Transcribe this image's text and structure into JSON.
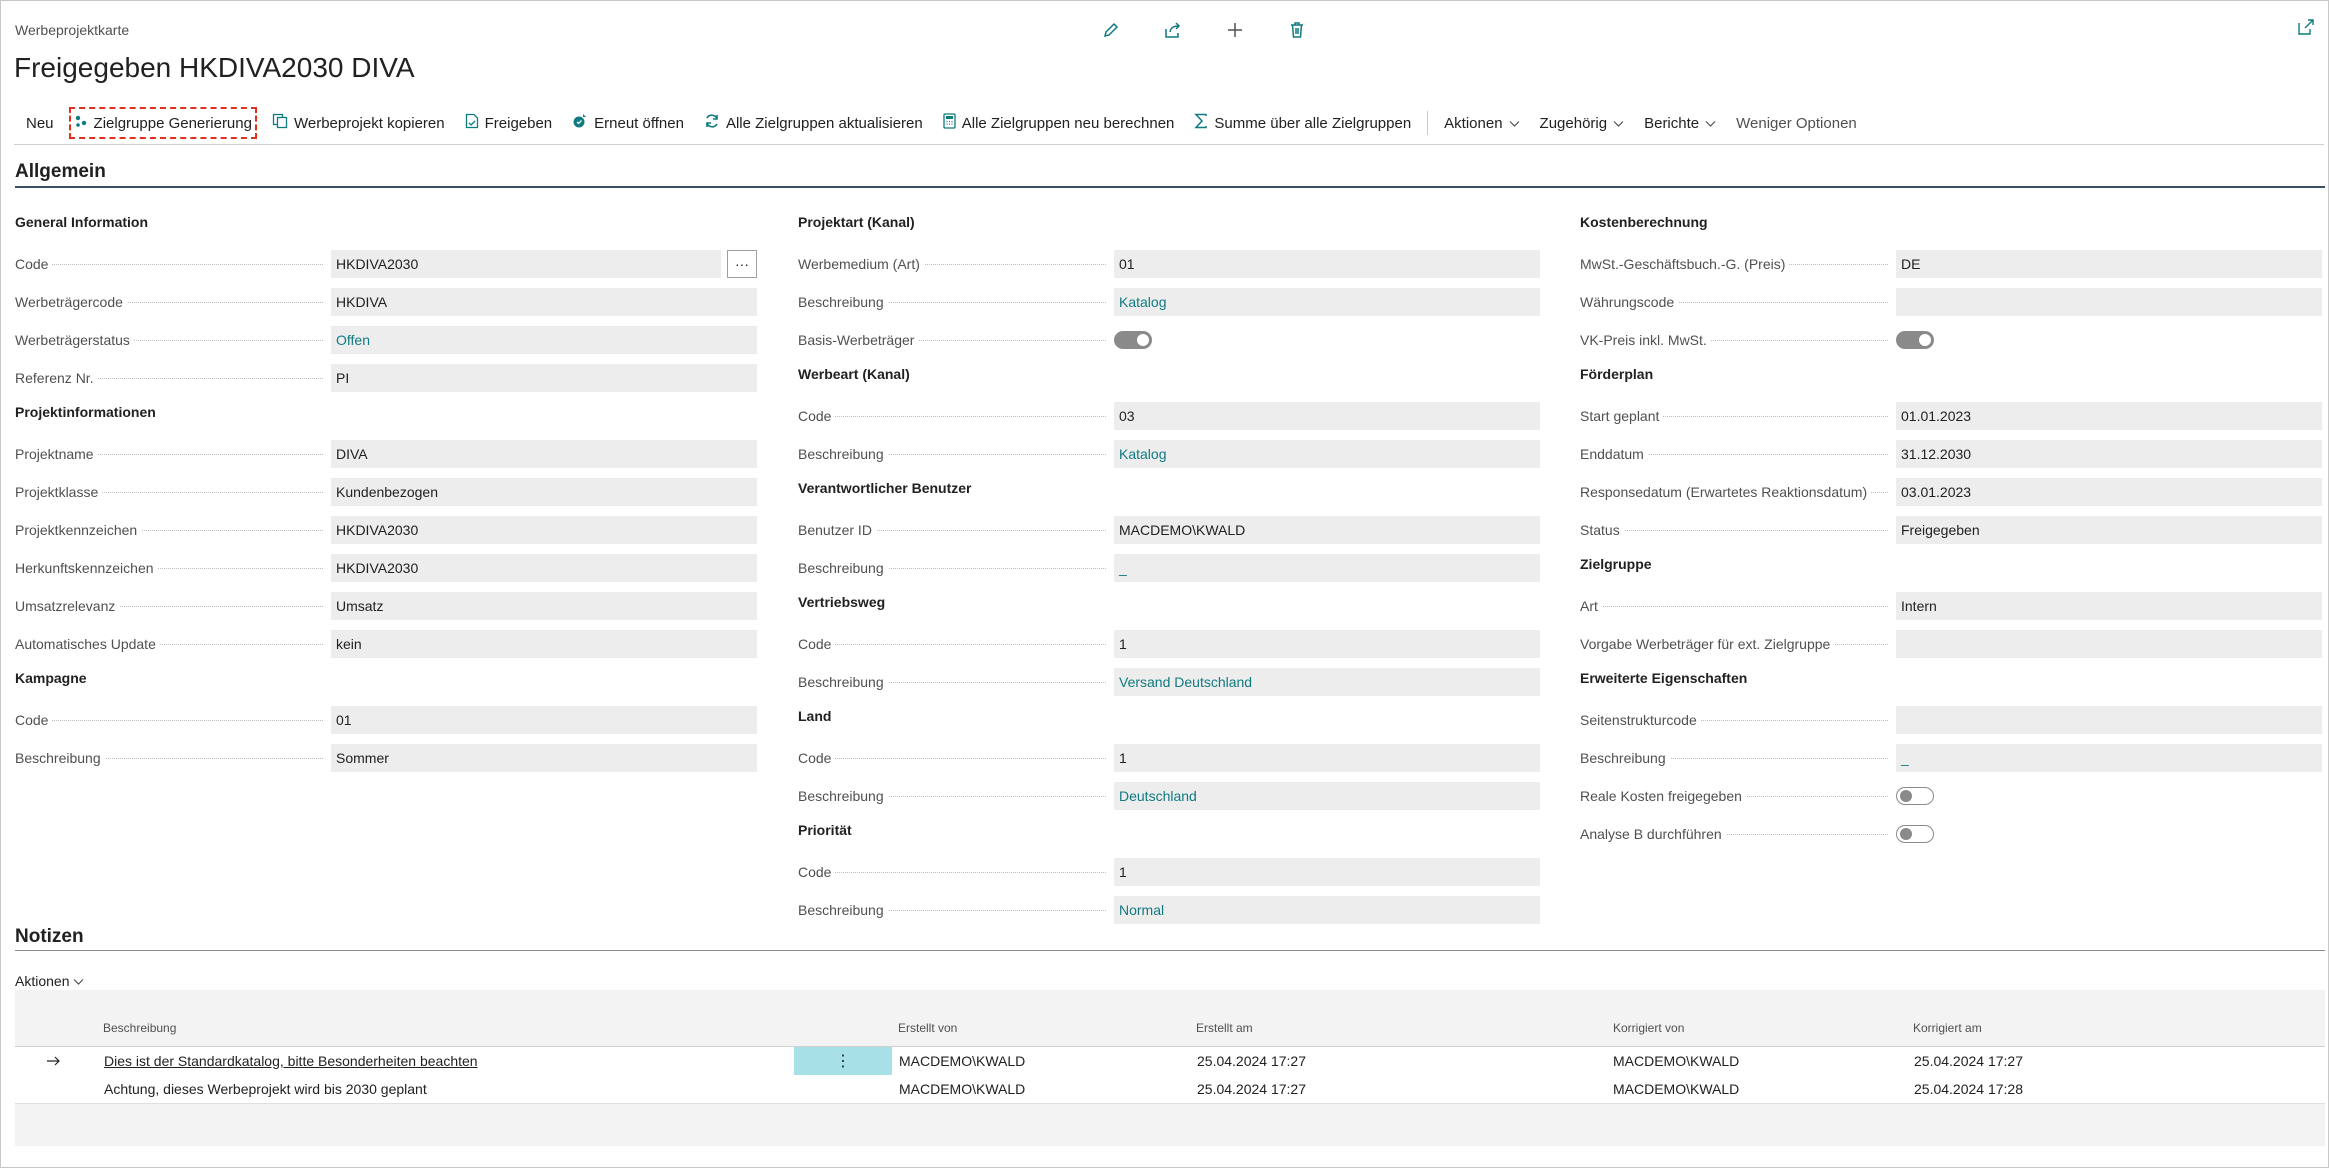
{
  "header": {
    "breadcrumb": "Werbeprojektkarte",
    "title": "Freigegeben HKDIVA2030 DIVA"
  },
  "topicons": [
    "edit-icon",
    "share-icon",
    "add-icon",
    "delete-icon"
  ],
  "toolbar": {
    "new": "Neu",
    "generate": "Zielgruppe Generierung",
    "copy": "Werbeprojekt kopieren",
    "release": "Freigeben",
    "reopen": "Erneut öffnen",
    "update_all": "Alle Zielgruppen aktualisieren",
    "recalc_all": "Alle Zielgruppen neu berechnen",
    "sum_all": "Summe über alle Zielgruppen",
    "actions": "Aktionen",
    "related": "Zugehörig",
    "reports": "Berichte",
    "fewer": "Weniger Optionen"
  },
  "general": {
    "heading": "Allgemein",
    "col1": {
      "g1": "General Information",
      "code_l": "Code",
      "code_v": "HKDIVA2030",
      "wtc_l": "Werbeträgercode",
      "wtc_v": "HKDIVA",
      "wts_l": "Werbeträgerstatus",
      "wts_v": "Offen",
      "ref_l": "Referenz Nr.",
      "ref_v": "PI",
      "g2": "Projektinformationen",
      "pn_l": "Projektname",
      "pn_v": "DIVA",
      "pk_l": "Projektklasse",
      "pk_v": "Kundenbezogen",
      "pkz_l": "Projektkennzeichen",
      "pkz_v": "HKDIVA2030",
      "hk_l": "Herkunftskennzeichen",
      "hk_v": "HKDIVA2030",
      "ur_l": "Umsatzrelevanz",
      "ur_v": "Umsatz",
      "au_l": "Automatisches Update",
      "au_v": "kein",
      "g3": "Kampagne",
      "kc_l": "Code",
      "kc_v": "01",
      "kb_l": "Beschreibung",
      "kb_v": "Sommer"
    },
    "col2": {
      "g1": "Projektart (Kanal)",
      "wm_l": "Werbemedium (Art)",
      "wm_v": "01",
      "b1_l": "Beschreibung",
      "b1_v": "Katalog",
      "bw_l": "Basis-Werbeträger",
      "g2": "Werbeart (Kanal)",
      "c2_l": "Code",
      "c2_v": "03",
      "b2_l": "Beschreibung",
      "b2_v": "Katalog",
      "g3": "Verantwortlicher Benutzer",
      "uid_l": "Benutzer ID",
      "uid_v": "MACDEMO\\KWALD",
      "b3_l": "Beschreibung",
      "b3_v": "_",
      "g4": "Vertriebsweg",
      "c4_l": "Code",
      "c4_v": "1",
      "b4_l": "Beschreibung",
      "b4_v": "Versand Deutschland",
      "g5": "Land",
      "c5_l": "Code",
      "c5_v": "1",
      "b5_l": "Beschreibung",
      "b5_v": "Deutschland",
      "g6": "Priorität",
      "c6_l": "Code",
      "c6_v": "1",
      "b6_l": "Beschreibung",
      "b6_v": "Normal"
    },
    "col3": {
      "g1": "Kostenberechnung",
      "mw_l": "MwSt.-Geschäftsbuch.-G. (Preis)",
      "mw_v": "DE",
      "wc_l": "Währungscode",
      "wc_v": "",
      "vk_l": "VK-Preis inkl. MwSt.",
      "g2": "Förderplan",
      "sg_l": "Start geplant",
      "sg_v": "01.01.2023",
      "ed_l": "Enddatum",
      "ed_v": "31.12.2030",
      "rd_l": "Responsedatum (Erwartetes Reaktionsdatum)",
      "rd_v": "03.01.2023",
      "st_l": "Status",
      "st_v": "Freigegeben",
      "g3": "Zielgruppe",
      "art_l": "Art",
      "art_v": "Intern",
      "vw_l": "Vorgabe Werbeträger für ext. Zielgruppe",
      "vw_v": "",
      "g4": "Erweiterte Eigenschaften",
      "ss_l": "Seitenstrukturcode",
      "ss_v": "",
      "eb_l": "Beschreibung",
      "eb_v": "_",
      "rk_l": "Reale Kosten freigegeben",
      "ab_l": "Analyse B durchführen"
    },
    "toggles": {
      "basis_werbetraeger": true,
      "vk_preis_inkl": true,
      "reale_kosten": false,
      "analyse_b": false
    }
  },
  "notes": {
    "heading": "Notizen",
    "actions": "Aktionen",
    "columns": [
      "Beschreibung",
      "Erstellt von",
      "Erstellt am",
      "Korrigiert von",
      "Korrigiert am"
    ],
    "rows": [
      [
        "Dies ist der Standardkatalog, bitte Besonderheiten beachten",
        "MACDEMO\\KWALD",
        "25.04.2024 17:27",
        "MACDEMO\\KWALD",
        "25.04.2024 17:27"
      ],
      [
        "Achtung, dieses Werbeprojekt wird bis 2030 geplant",
        "MACDEMO\\KWALD",
        "25.04.2024 17:27",
        "MACDEMO\\KWALD",
        "25.04.2024 17:28"
      ]
    ]
  },
  "colors": {
    "accent": "#0f7a80",
    "selection": "#a8e0e8",
    "field_bg": "#ededed",
    "focus": "#e0301e"
  }
}
